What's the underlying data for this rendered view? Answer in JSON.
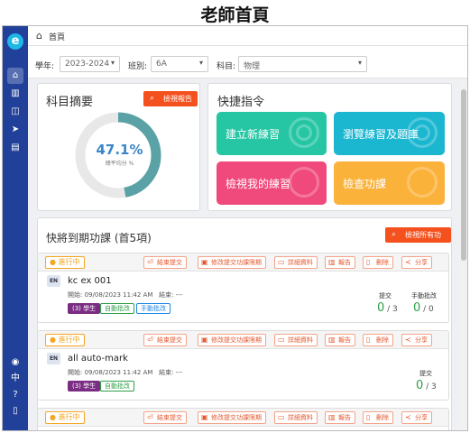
{
  "page_title": "老師首頁",
  "sidebar": {
    "logo_icon": "e-logo",
    "top_icons": [
      "home-icon",
      "books-icon",
      "folder-icon",
      "send-icon",
      "clipboard-icon"
    ],
    "lang_label": "中",
    "bottom_icons": [
      "user-icon",
      "language-icon",
      "help-icon",
      "logout-icon"
    ]
  },
  "breadcrumb": {
    "home_label": "首頁"
  },
  "filters": {
    "year_label": "學年:",
    "year_value": "2023-2024",
    "class_label": "班別:",
    "class_value": "6A",
    "subject_label": "科目:",
    "subject_value": "物理"
  },
  "summary": {
    "title": "科目摘要",
    "report_button": "檢視報告",
    "class_name": "6A",
    "percent": "47.1%",
    "percent_value": 47.1,
    "caption": "總平均分 %"
  },
  "quick": {
    "title": "快捷指令",
    "tiles": [
      {
        "label": "建立新練習",
        "color": "#26c6a4"
      },
      {
        "label": "瀏覽練習及題庫",
        "color": "#1bb6d0"
      },
      {
        "label": "檢視我的練習",
        "color": "#f04a7c"
      },
      {
        "label": "檢查功課",
        "color": "#fbb23b"
      }
    ]
  },
  "upcoming": {
    "title": "快將到期功課 (首5項)",
    "view_all": "檢視所有功課",
    "status": "進行中",
    "actions": [
      "結束提交",
      "修改提交功課限期",
      "詳細資料",
      "報告",
      "刪除",
      "分享"
    ],
    "items": [
      {
        "lang": "EN",
        "name": "kc ex 001",
        "start_label": "開始:",
        "start": "09/08/2023 11:42 AM",
        "end_label": "結束:",
        "end": "---",
        "tags": [
          "(3) 學生",
          "自動批改",
          "手動批改"
        ],
        "submitted_label": "提交",
        "submitted": "0",
        "submitted_total": "/ 3",
        "manual_label": "手動批改",
        "manual": "0",
        "manual_total": "/ 0"
      },
      {
        "lang": "EN",
        "name": "all auto-mark",
        "start_label": "開始:",
        "start": "09/08/2023 11:42 AM",
        "end_label": "結束:",
        "end": "---",
        "tags": [
          "(3) 學生",
          "自動批改"
        ],
        "submitted_label": "提交",
        "submitted": "0",
        "submitted_total": "/ 3"
      }
    ]
  },
  "colors": {
    "sidebar": "#21409a",
    "accent": "#f4511e",
    "gauge": "#5aa2a6",
    "success": "#2e9e4a"
  }
}
